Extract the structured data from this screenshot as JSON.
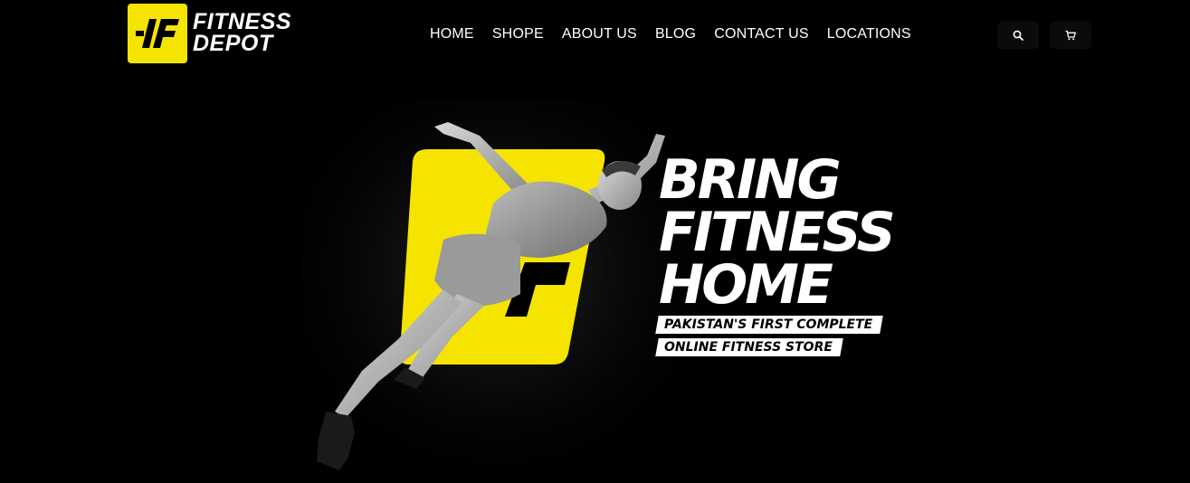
{
  "brand": {
    "line1": "FITNESS",
    "line2": "DEPOT",
    "accent_color": "#f5e400",
    "logo_icon": "fitness-depot-logo-icon"
  },
  "nav": {
    "items": [
      {
        "label": "HOME"
      },
      {
        "label": "SHOPE"
      },
      {
        "label": "ABOUT US"
      },
      {
        "label": "BLOG"
      },
      {
        "label": "CONTACT US"
      },
      {
        "label": "LOCATIONS"
      }
    ]
  },
  "header_icons": {
    "search": "search-icon",
    "cart": "cart-icon"
  },
  "hero": {
    "headline": [
      "BRING",
      "FITNESS",
      "HOME"
    ],
    "tagline_line1": "PAKISTAN'S FIRST COMPLETE",
    "tagline_line2": "ONLINE FITNESS STORE",
    "image": "sprinting-athlete-image"
  }
}
